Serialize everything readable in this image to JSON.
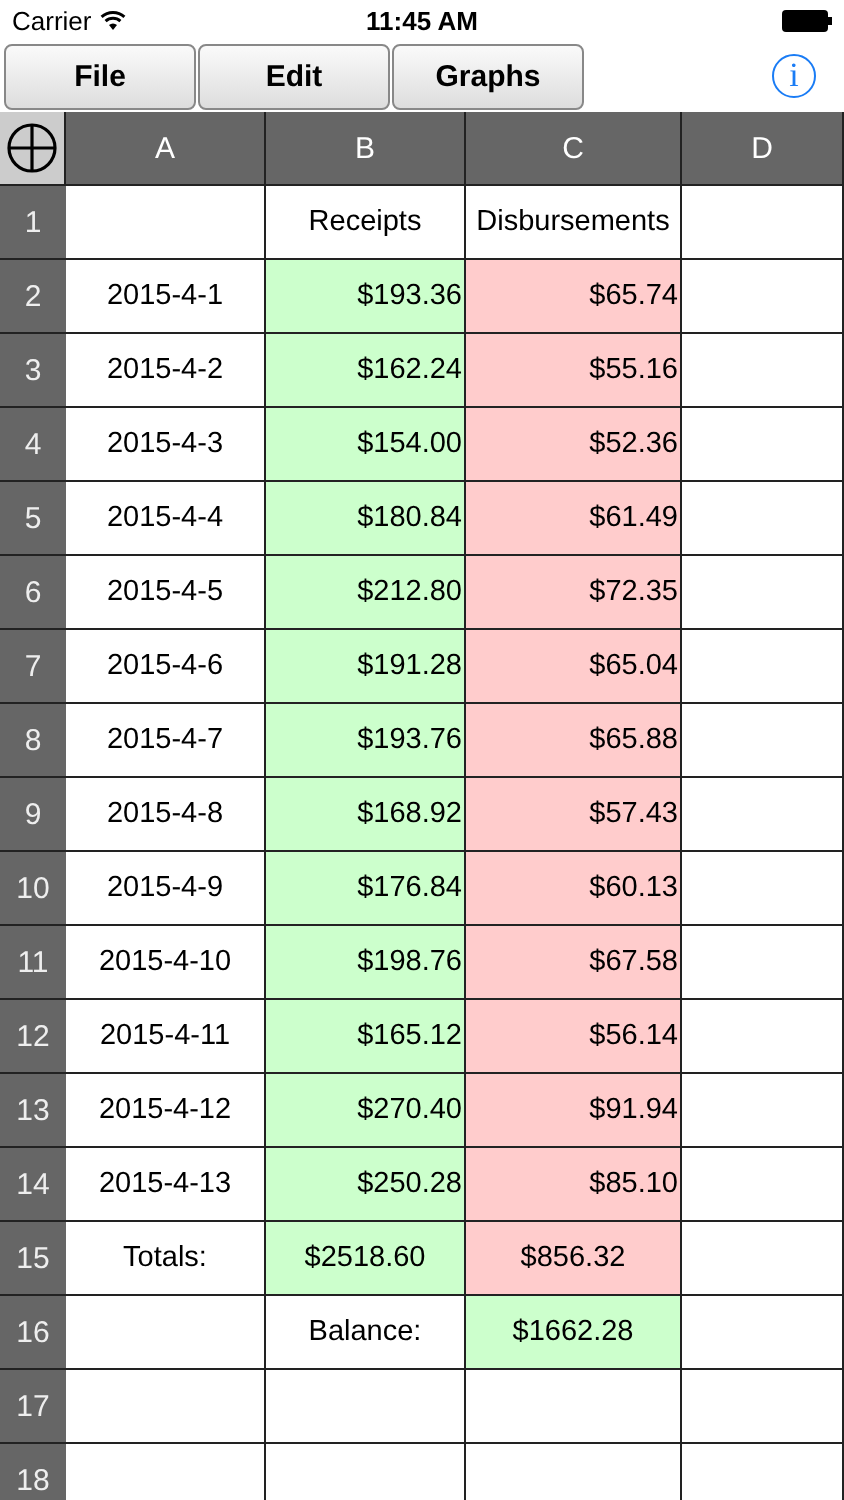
{
  "status_bar": {
    "carrier": "Carrier",
    "time": "11:45 AM"
  },
  "toolbar": {
    "buttons": [
      "File",
      "Edit",
      "Graphs"
    ],
    "info_button": "i"
  },
  "sheet": {
    "columns": [
      "A",
      "B",
      "C",
      "D"
    ],
    "rows": [
      {
        "number": "1",
        "cells": [
          {
            "kind": "empty"
          },
          {
            "kind": "text",
            "text": "Receipts"
          },
          {
            "kind": "text",
            "text": "Disbursements"
          },
          {
            "kind": "empty"
          }
        ]
      },
      {
        "number": "2",
        "cells": [
          {
            "kind": "text",
            "text": "2015-4-1"
          },
          {
            "kind": "amount",
            "text": "$193.36",
            "color": "#ccffcc"
          },
          {
            "kind": "amount",
            "text": "$65.74",
            "color": "#ffcccc"
          },
          {
            "kind": "empty"
          }
        ]
      },
      {
        "number": "3",
        "cells": [
          {
            "kind": "text",
            "text": "2015-4-2"
          },
          {
            "kind": "amount",
            "text": "$162.24",
            "color": "#ccffcc"
          },
          {
            "kind": "amount",
            "text": "$55.16",
            "color": "#ffcccc"
          },
          {
            "kind": "empty"
          }
        ]
      },
      {
        "number": "4",
        "cells": [
          {
            "kind": "text",
            "text": "2015-4-3"
          },
          {
            "kind": "amount",
            "text": "$154.00",
            "color": "#ccffcc"
          },
          {
            "kind": "amount",
            "text": "$52.36",
            "color": "#ffcccc"
          },
          {
            "kind": "empty"
          }
        ]
      },
      {
        "number": "5",
        "cells": [
          {
            "kind": "text",
            "text": "2015-4-4"
          },
          {
            "kind": "amount",
            "text": "$180.84",
            "color": "#ccffcc"
          },
          {
            "kind": "amount",
            "text": "$61.49",
            "color": "#ffcccc"
          },
          {
            "kind": "empty"
          }
        ]
      },
      {
        "number": "6",
        "cells": [
          {
            "kind": "text",
            "text": "2015-4-5"
          },
          {
            "kind": "amount",
            "text": "$212.80",
            "color": "#ccffcc"
          },
          {
            "kind": "amount",
            "text": "$72.35",
            "color": "#ffcccc"
          },
          {
            "kind": "empty"
          }
        ]
      },
      {
        "number": "7",
        "cells": [
          {
            "kind": "text",
            "text": "2015-4-6"
          },
          {
            "kind": "amount",
            "text": "$191.28",
            "color": "#ccffcc"
          },
          {
            "kind": "amount",
            "text": "$65.04",
            "color": "#ffcccc"
          },
          {
            "kind": "empty"
          }
        ]
      },
      {
        "number": "8",
        "cells": [
          {
            "kind": "text",
            "text": "2015-4-7"
          },
          {
            "kind": "amount",
            "text": "$193.76",
            "color": "#ccffcc"
          },
          {
            "kind": "amount",
            "text": "$65.88",
            "color": "#ffcccc"
          },
          {
            "kind": "empty"
          }
        ]
      },
      {
        "number": "9",
        "cells": [
          {
            "kind": "text",
            "text": "2015-4-8"
          },
          {
            "kind": "amount",
            "text": "$168.92",
            "color": "#ccffcc"
          },
          {
            "kind": "amount",
            "text": "$57.43",
            "color": "#ffcccc"
          },
          {
            "kind": "empty"
          }
        ]
      },
      {
        "number": "10",
        "cells": [
          {
            "kind": "text",
            "text": "2015-4-9"
          },
          {
            "kind": "amount",
            "text": "$176.84",
            "color": "#ccffcc"
          },
          {
            "kind": "amount",
            "text": "$60.13",
            "color": "#ffcccc"
          },
          {
            "kind": "empty"
          }
        ]
      },
      {
        "number": "11",
        "cells": [
          {
            "kind": "text",
            "text": "2015-4-10"
          },
          {
            "kind": "amount",
            "text": "$198.76",
            "color": "#ccffcc"
          },
          {
            "kind": "amount",
            "text": "$67.58",
            "color": "#ffcccc"
          },
          {
            "kind": "empty"
          }
        ]
      },
      {
        "number": "12",
        "cells": [
          {
            "kind": "text",
            "text": "2015-4-11"
          },
          {
            "kind": "amount",
            "text": "$165.12",
            "color": "#ccffcc"
          },
          {
            "kind": "amount",
            "text": "$56.14",
            "color": "#ffcccc"
          },
          {
            "kind": "empty"
          }
        ]
      },
      {
        "number": "13",
        "cells": [
          {
            "kind": "text",
            "text": "2015-4-12"
          },
          {
            "kind": "amount",
            "text": "$270.40",
            "color": "#ccffcc"
          },
          {
            "kind": "amount",
            "text": "$91.94",
            "color": "#ffcccc"
          },
          {
            "kind": "empty"
          }
        ]
      },
      {
        "number": "14",
        "cells": [
          {
            "kind": "text",
            "text": "2015-4-13"
          },
          {
            "kind": "amount",
            "text": "$250.28",
            "color": "#ccffcc"
          },
          {
            "kind": "amount",
            "text": "$85.10",
            "color": "#ffcccc"
          },
          {
            "kind": "empty"
          }
        ]
      },
      {
        "number": "15",
        "cells": [
          {
            "kind": "text",
            "text": "Totals:"
          },
          {
            "kind": "text",
            "text": "$2518.60",
            "color": "#ccffcc"
          },
          {
            "kind": "text",
            "text": "$856.32",
            "color": "#ffcccc"
          },
          {
            "kind": "empty"
          }
        ]
      },
      {
        "number": "16",
        "cells": [
          {
            "kind": "empty"
          },
          {
            "kind": "text",
            "text": "Balance:"
          },
          {
            "kind": "text",
            "text": "$1662.28",
            "color": "#ccffcc"
          },
          {
            "kind": "empty"
          }
        ]
      },
      {
        "number": "17",
        "cells": [
          {
            "kind": "empty"
          },
          {
            "kind": "empty"
          },
          {
            "kind": "empty"
          },
          {
            "kind": "empty"
          }
        ]
      },
      {
        "number": "18",
        "cells": [
          {
            "kind": "empty"
          },
          {
            "kind": "empty"
          },
          {
            "kind": "empty"
          },
          {
            "kind": "empty"
          }
        ]
      }
    ]
  }
}
